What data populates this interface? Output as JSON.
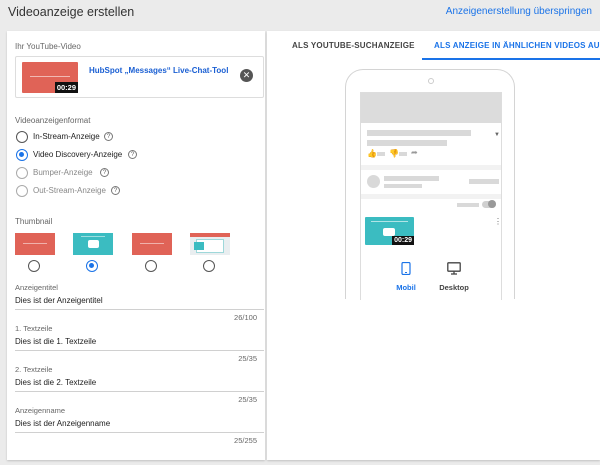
{
  "header": {
    "title": "Videoanzeige erstellen",
    "skip_label": "Anzeigenerstellung überspringen"
  },
  "video": {
    "section_label": "Ihr YouTube-Video",
    "title": "HubSpot „Messages“ Live-Chat-Tool",
    "duration": "00:29"
  },
  "format": {
    "section_label": "Videoanzeigenformat",
    "options": [
      {
        "label": "In-Stream-Anzeige",
        "selected": false,
        "disabled": false
      },
      {
        "label": "Video Discovery-Anzeige",
        "selected": true,
        "disabled": false
      },
      {
        "label": "Bumper-Anzeige",
        "selected": false,
        "disabled": true
      },
      {
        "label": "Out-Stream-Anzeige",
        "selected": false,
        "disabled": true
      }
    ]
  },
  "thumbnail": {
    "section_label": "Thumbnail",
    "selected_index": 1
  },
  "fields": {
    "headline": {
      "label": "Anzeigentitel",
      "value": "Dies ist der Anzeigentitel",
      "counter": "26/100"
    },
    "line1": {
      "label": "1. Textzeile",
      "value": "Dies ist die 1. Textzeile",
      "counter": "25/35"
    },
    "line2": {
      "label": "2. Textzeile",
      "value": "Dies ist die 2. Textzeile",
      "counter": "25/35"
    },
    "ad_name": {
      "label": "Anzeigenname",
      "value": "Dies ist der Anzeigenname",
      "counter": "25/255"
    }
  },
  "preview": {
    "tabs": [
      {
        "label": "ALS YOUTUBE-SUCHANZEIGE",
        "active": false
      },
      {
        "label": "ALS ANZEIGE IN ÄHNLICHEN VIDEOS AUF Y",
        "active": true
      }
    ],
    "devices": [
      {
        "label": "Mobil",
        "icon": "smartphone-icon",
        "active": true
      },
      {
        "label": "Desktop",
        "icon": "monitor-icon",
        "active": false
      }
    ],
    "duration": "00:29"
  },
  "colors": {
    "accent": "#1a73e8",
    "thumbnail_red": "#e06357",
    "thumbnail_teal": "#3bbcc1"
  }
}
